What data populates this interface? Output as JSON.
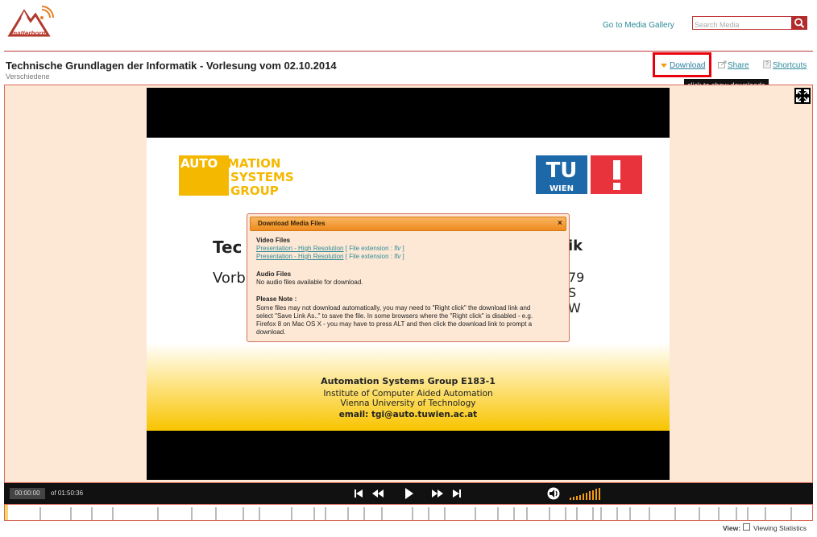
{
  "header": {
    "logo_text": "matterhorn",
    "gallery_link": "Go to Media Gallery",
    "search_placeholder": "Search Media",
    "title": "Technische Grundlagen der Informatik - Vorlesung vom 02.10.2014",
    "subtitle": "Verschiedene",
    "actions": {
      "download": "Download",
      "share": "Share",
      "shortcuts": "Shortcuts"
    },
    "tooltip": "click to show downloads",
    "highlight_color": "#e8000c"
  },
  "slide": {
    "logo_left": [
      "AUTOMATION",
      "SYSTEMS",
      "GROUP"
    ],
    "logo_right": [
      "TU",
      "WIEN"
    ],
    "heading_left": "Tec",
    "heading_right": "ik",
    "sub_left": "Vorb",
    "right_fragments": [
      "79",
      "S",
      "W"
    ],
    "footer": [
      "Automation Systems Group E183-1",
      "Institute of Computer Aided Automation",
      "Vienna University of Technology",
      "email: tgi@auto.tuwien.ac.at"
    ]
  },
  "dialog": {
    "title": "Download Media Files",
    "close": "×",
    "video_heading": "Video Files",
    "video_files": [
      {
        "label": "Presentation - High Resolution",
        "ext_prefix": "[ File extension : ",
        "ext": "flv",
        "ext_suffix": " ]"
      },
      {
        "label": "Presentation - High Resolution",
        "ext_prefix": "[ File extension : ",
        "ext": "flv",
        "ext_suffix": " ]"
      }
    ],
    "audio_heading": "Audio Files",
    "audio_text": "No audio files available for download.",
    "note_heading": "Please Note :",
    "note_lines": [
      "Some files may not download automatically, you may need to \"Right click\" the download link and",
      "select \"Save Link As..\" to save the file. In some browsers where the \"Right click\" is disabled - e.g.",
      "Firefox 8 on Mac OS X - you may have to press ALT and then click the download link to prompt a",
      "download."
    ]
  },
  "controls": {
    "current_time": "00:00:00",
    "duration": "of 01:50:36",
    "icons": [
      "skip-back-icon",
      "rewind-icon",
      "play-icon",
      "fast-forward-icon",
      "skip-forward-icon",
      "volume-icon"
    ],
    "volume_color": "#f39c12",
    "volume_level": 1.0
  },
  "footer": {
    "view_label": "View:",
    "viewing_statistics": "Viewing Statistics"
  },
  "colors": {
    "accent": "#c0393b",
    "link": "#2e8b9a",
    "player_bg": "#fde7d5",
    "dialog_header": "#ee8a1e"
  }
}
